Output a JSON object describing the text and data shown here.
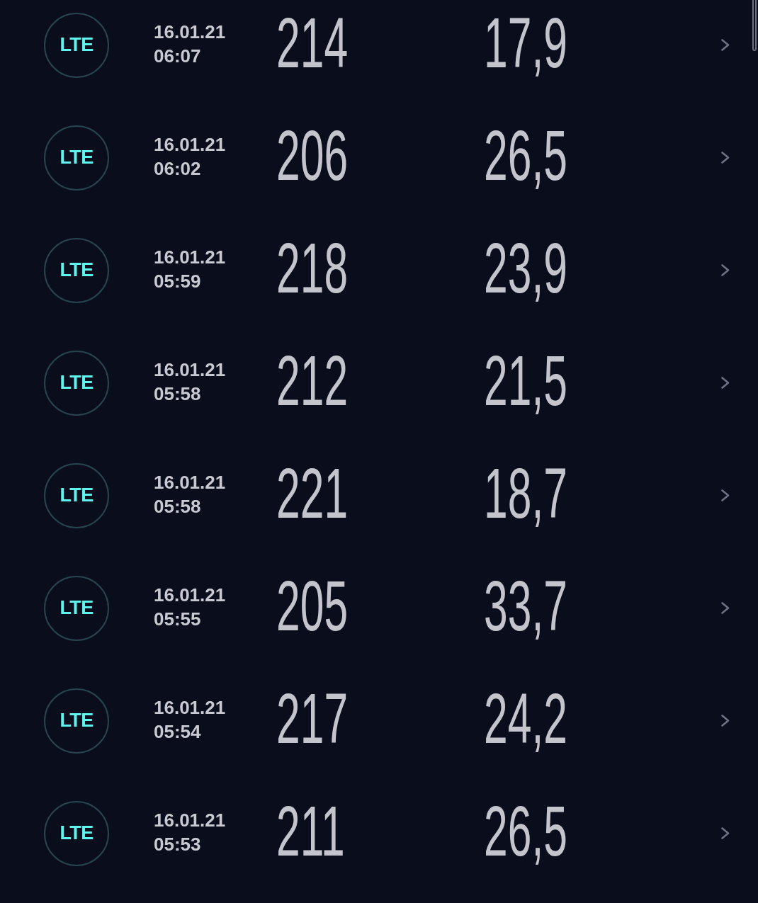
{
  "rows": [
    {
      "badge": "LTE",
      "date": "16.01.21",
      "time": "06:07",
      "column_3": "214",
      "column_4": "17,9"
    },
    {
      "badge": "LTE",
      "date": "16.01.21",
      "time": "06:02",
      "column_3": "206",
      "column_4": "26,5"
    },
    {
      "badge": "LTE",
      "date": "16.01.21",
      "time": "05:59",
      "column_3": "218",
      "column_4": "23,9"
    },
    {
      "badge": "LTE",
      "date": "16.01.21",
      "time": "05:58",
      "column_3": "212",
      "column_4": "21,5"
    },
    {
      "badge": "LTE",
      "date": "16.01.21",
      "time": "05:58",
      "column_3": "221",
      "column_4": "18,7"
    },
    {
      "badge": "LTE",
      "date": "16.01.21",
      "time": "05:55",
      "column_3": "205",
      "column_4": "33,7"
    },
    {
      "badge": "LTE",
      "date": "16.01.21",
      "time": "05:54",
      "column_3": "217",
      "column_4": "24,2"
    },
    {
      "badge": "LTE",
      "date": "16.01.21",
      "time": "05:53",
      "column_3": "211",
      "column_4": "26,5"
    }
  ]
}
